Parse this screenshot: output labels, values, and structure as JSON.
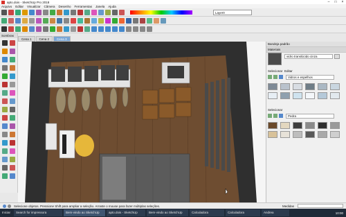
{
  "window": {
    "title": "apto.dois - SketchUp Pro 2018"
  },
  "menu": [
    "Arquivo",
    "Editar",
    "Visualizar",
    "Câmera",
    "Desenho",
    "Ferramentas",
    "Janela",
    "Ajuda"
  ],
  "layer": {
    "value": "Layer0"
  },
  "left_panel_label": "Sombras",
  "scene_tabs": [
    {
      "label": "Cena 1",
      "active": false
    },
    {
      "label": "Cena 2",
      "active": false
    },
    {
      "label": "Cena 3",
      "active": true
    }
  ],
  "tray": {
    "title": "Bandeja padrão",
    "materials_header": "Materiais",
    "material_name": "vidro translúcido cinza",
    "select_label": "Selecionar",
    "edit_label": "Editar",
    "collection1": "Vidros e espelhos",
    "select_label2": "Selecionar",
    "collection2": "Pedra",
    "colors": {
      "glass": [
        "#7e8a96",
        "#b9c2cc",
        "#d8dde3",
        "#6f7d87",
        "#aab8c4",
        "#c9d6e0",
        "#e7eef4",
        "#8fa0ae",
        "#cfe3ef",
        "#f4f7fa",
        "#b5c9d9",
        "#e2e9ee"
      ],
      "stone": [
        "#6b4a2a",
        "#e3d7bf",
        "#3d3d3d",
        "#8a8a8a",
        "#2e2e2e",
        "#9a9a9a",
        "#d8c29a",
        "#e7e2d8",
        "#bdbdbd",
        "#585858",
        "#a9a9a9",
        "#cfcfcf"
      ]
    }
  },
  "status": {
    "text": "Selecione objetos. Pressione Shift para ampliar a seleção. Arraste o mouse para fazer múltiplas seleções.",
    "measure_label": "Medidas"
  },
  "taskbar": [
    {
      "label": "Iniciar",
      "active": false
    },
    {
      "label": "Search for impressora",
      "active": false
    },
    {
      "label": "Bem-vindo ao SketchUp",
      "active": true
    },
    {
      "label": "apto.dois - SketchUp",
      "active": false
    },
    {
      "label": "Bem-vindo ao SketchUp",
      "active": false
    },
    {
      "label": "Calculadora",
      "active": false
    },
    {
      "label": "Calculadora",
      "active": false
    },
    {
      "label": "Andrea",
      "active": false
    }
  ],
  "clock": "10:00",
  "colors": {
    "accent": "#2d6bb6",
    "viewport_floor": "#7a5636",
    "wall": "#c9c9c9"
  }
}
